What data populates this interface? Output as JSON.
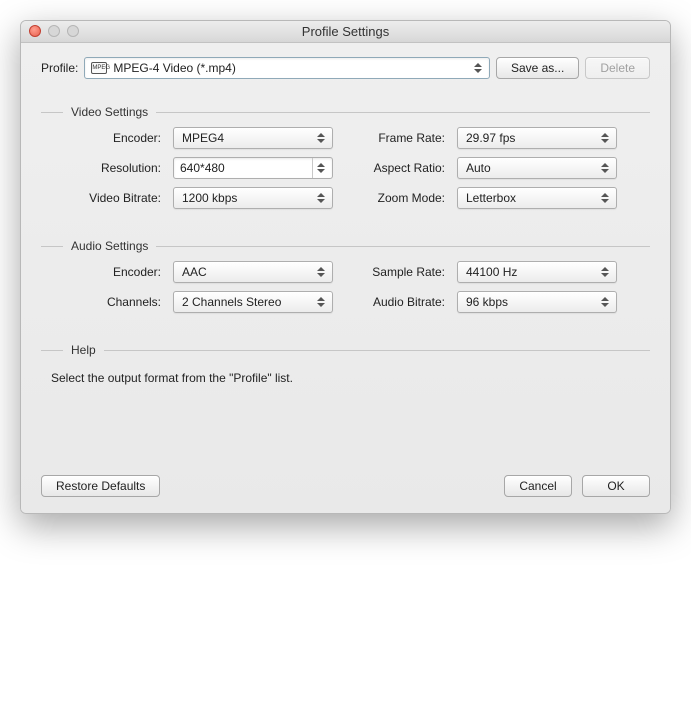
{
  "window": {
    "title": "Profile Settings"
  },
  "profile": {
    "label": "Profile:",
    "icon_text": "MPEG",
    "value": "MPEG-4 Video (*.mp4)",
    "save_as_label": "Save as...",
    "delete_label": "Delete"
  },
  "video": {
    "group_title": "Video Settings",
    "encoder_label": "Encoder:",
    "encoder_value": "MPEG4",
    "resolution_label": "Resolution:",
    "resolution_value": "640*480",
    "video_bitrate_label": "Video Bitrate:",
    "video_bitrate_value": "1200 kbps",
    "frame_rate_label": "Frame Rate:",
    "frame_rate_value": "29.97 fps",
    "aspect_ratio_label": "Aspect Ratio:",
    "aspect_ratio_value": "Auto",
    "zoom_mode_label": "Zoom Mode:",
    "zoom_mode_value": "Letterbox"
  },
  "audio": {
    "group_title": "Audio Settings",
    "encoder_label": "Encoder:",
    "encoder_value": "AAC",
    "channels_label": "Channels:",
    "channels_value": "2 Channels Stereo",
    "sample_rate_label": "Sample Rate:",
    "sample_rate_value": "44100 Hz",
    "audio_bitrate_label": "Audio Bitrate:",
    "audio_bitrate_value": "96 kbps"
  },
  "help": {
    "group_title": "Help",
    "text": "Select the output format from the \"Profile\" list."
  },
  "footer": {
    "restore_label": "Restore Defaults",
    "cancel_label": "Cancel",
    "ok_label": "OK"
  }
}
